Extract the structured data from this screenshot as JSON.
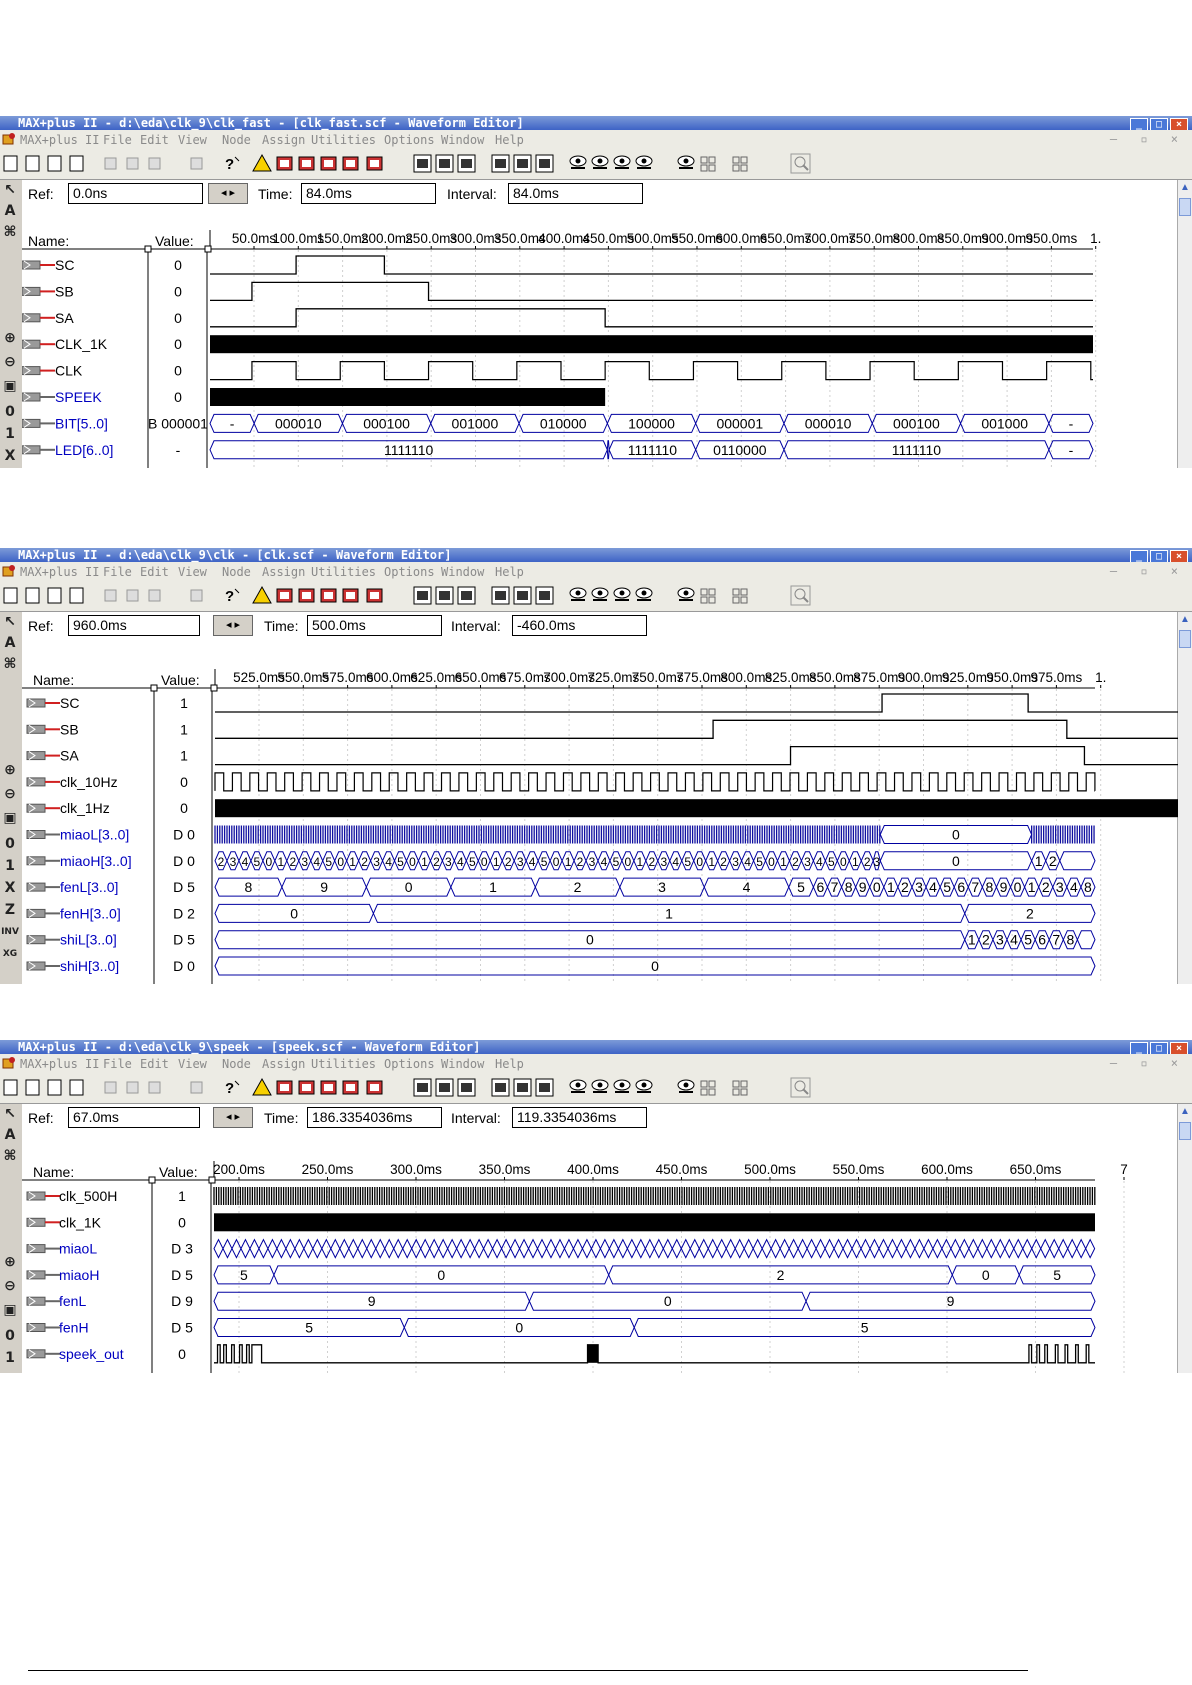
{
  "menu_items": [
    "MAX+plus II",
    "File",
    "Edit",
    "View",
    "Node",
    "Assign",
    "Utilities",
    "Options",
    "Window",
    "Help"
  ],
  "labels": {
    "ref": "Ref:",
    "time": "Time:",
    "interval": "Interval:",
    "name": "Name:",
    "value": "Value:"
  },
  "colors": {
    "input_name": "#000000",
    "output_name": "#0000c0",
    "title_grad_top": "#7d9bd8",
    "title_grad_bottom": "#3e63c6"
  },
  "windows": [
    {
      "title": "MAX+plus II - d:\\eda\\clk_9\\clk_fast - [clk_fast.scf - Waveform Editor]",
      "ref": "0.0ns",
      "time": "84.0ms",
      "interval": "84.0ms",
      "ticks": [
        "50.0ms",
        "100.0ms",
        "150.0ms",
        "200.0ms",
        "250.0ms",
        "300.0ms",
        "350.0ms",
        "400.0ms",
        "450.0ms",
        "500.0ms",
        "550.0ms",
        "600.0ms",
        "650.0ms",
        "700.0ms",
        "750.0ms",
        "800.0ms",
        "850.0ms",
        "900.0ms",
        "950.0ms",
        "1."
      ],
      "signals": [
        {
          "name": "SC",
          "value": "0",
          "type": "in",
          "kind": "bit",
          "t": [
            0,
            97.5,
            197.5,
            1000
          ],
          "v": [
            0,
            1,
            0
          ]
        },
        {
          "name": "SB",
          "value": "0",
          "type": "in",
          "kind": "bit",
          "t": [
            0,
            47.5,
            247.5,
            1000
          ],
          "v": [
            0,
            1,
            0
          ]
        },
        {
          "name": "SA",
          "value": "0",
          "type": "in",
          "kind": "bit",
          "t": [
            0,
            97.5,
            447.5,
            1000
          ],
          "v": [
            0,
            1,
            0
          ]
        },
        {
          "name": "CLK_1K",
          "value": "0",
          "type": "in",
          "kind": "fill",
          "ranges": [
            [
              0,
              1000
            ]
          ]
        },
        {
          "name": "CLK",
          "value": "0",
          "type": "in",
          "kind": "clock",
          "period": 100,
          "phase": 50
        },
        {
          "name": "SPEEK",
          "value": "0",
          "type": "out",
          "kind": "fill",
          "ranges": [
            [
              0,
              447.5
            ]
          ]
        },
        {
          "name": "BIT[5..0]",
          "value": "B 000001",
          "type": "out",
          "kind": "bus",
          "t": [
            0,
            50,
            150,
            250,
            350,
            450,
            550,
            650,
            750,
            850,
            950,
            1000
          ],
          "labels": [
            "-",
            "000010",
            "000100",
            "001000",
            "010000",
            "100000",
            "000001",
            "000010",
            "000100",
            "001000",
            "-"
          ]
        },
        {
          "name": "LED[6..0]",
          "value": "-",
          "type": "out",
          "kind": "bus",
          "t": [
            0,
            450,
            452,
            550,
            650,
            950,
            1000
          ],
          "labels": [
            "1111110",
            "",
            "1111110",
            "0110000",
            "1111110",
            "-"
          ]
        }
      ]
    },
    {
      "title": "MAX+plus II - d:\\eda\\clk_9\\clk - [clk.scf - Waveform Editor]",
      "ref": "960.0ms",
      "time": "500.0ms",
      "interval": "-460.0ms",
      "ticks": [
        "525.0ms",
        "550.0ms",
        "575.0ms",
        "600.0ms",
        "625.0ms",
        "650.0ms",
        "675.0ms",
        "700.0ms",
        "725.0ms",
        "750.0ms",
        "775.0ms",
        "800.0ms",
        "825.0ms",
        "850.0ms",
        "875.0ms",
        "900.0ms",
        "925.0ms",
        "950.0ms",
        "975.0ms",
        "1."
      ],
      "signals": [
        {
          "name": "SC",
          "value": "1",
          "type": "in",
          "kind": "bit",
          "t": [
            0,
            189.5,
            231,
            1000
          ],
          "v": [
            0,
            1,
            0
          ]
        },
        {
          "name": "SB",
          "value": "1",
          "type": "in",
          "kind": "bit",
          "t": [
            0,
            141.5,
            242,
            1000
          ],
          "v": [
            0,
            1,
            0
          ]
        },
        {
          "name": "SA",
          "value": "1",
          "type": "in",
          "kind": "bit",
          "t": [
            0,
            163.5,
            247,
            1000
          ],
          "v": [
            0,
            1,
            0
          ]
        },
        {
          "name": "clk_10Hz",
          "value": "0",
          "type": "in",
          "kind": "clock",
          "period": 4.95,
          "phase": 0
        },
        {
          "name": "clk_1Hz",
          "value": "0",
          "type": "in",
          "kind": "fill",
          "ranges": [
            [
              0,
              1000
            ]
          ]
        },
        {
          "name": "miaoL[3..0]",
          "value": "D 0",
          "type": "out",
          "kind": "dense",
          "ranges": [
            [
              0,
              189
            ],
            [
              232,
              250
            ]
          ],
          "gap_label": "0",
          "gap": [
            189,
            232
          ]
        },
        {
          "name": "miaoH[3..0]",
          "value": "D 0",
          "type": "out",
          "kind": "bus",
          "t": [
            0,
            3.4,
            6.8,
            10.2,
            13.6,
            17,
            20.4,
            23.8,
            27.2,
            30.6,
            34,
            37.4,
            40.8,
            44.2,
            47.6,
            51,
            54.4,
            57.8,
            61.2,
            64.6,
            68,
            71.4,
            74.8,
            78.2,
            81.6,
            85,
            88.4,
            91.8,
            95.2,
            98.6,
            102,
            105.4,
            108.8,
            112.2,
            115.6,
            119,
            122.4,
            125.8,
            129.2,
            132.6,
            136,
            139.4,
            142.8,
            146.2,
            149.6,
            153,
            156.4,
            159.8,
            163.2,
            166.6,
            170,
            173.4,
            176.8,
            180.2,
            183.6,
            187,
            189,
            232,
            236,
            240,
            250
          ],
          "labels": [
            "2",
            "3",
            "4",
            "5",
            "0",
            "1",
            "2",
            "3",
            "4",
            "5",
            "0",
            "1",
            "2",
            "3",
            "4",
            "5",
            "0",
            "1",
            "2",
            "3",
            "4",
            "5",
            "0",
            "1",
            "2",
            "3",
            "4",
            "5",
            "0",
            "1",
            "2",
            "3",
            "4",
            "5",
            "0",
            "1",
            "2",
            "3",
            "4",
            "5",
            "0",
            "1",
            "2",
            "3",
            "4",
            "5",
            "0",
            "1",
            "2",
            "3",
            "4",
            "5",
            "0",
            "1",
            "2",
            "3",
            "0",
            "1",
            "2",
            ""
          ]
        },
        {
          "name": "fenL[3..0]",
          "value": "D 5",
          "type": "out",
          "kind": "bus",
          "t": [
            0,
            19,
            43,
            67,
            91,
            115,
            139,
            163,
            170,
            174,
            178,
            182,
            186,
            190,
            194,
            198,
            202,
            206,
            210,
            214,
            218,
            222,
            226,
            230,
            234,
            238,
            242,
            246,
            250
          ],
          "labels": [
            "8",
            "9",
            "0",
            "1",
            "2",
            "3",
            "4",
            "5",
            "6",
            "7",
            "8",
            "9",
            "0",
            "1",
            "2",
            "3",
            "4",
            "5",
            "6",
            "7",
            "8",
            "9",
            "0",
            "1",
            "2",
            "3",
            "4",
            "8"
          ]
        },
        {
          "name": "fenH[3..0]",
          "value": "D 2",
          "type": "out",
          "kind": "bus",
          "t": [
            0,
            45,
            213,
            250
          ],
          "labels": [
            "0",
            "1",
            "2"
          ]
        },
        {
          "name": "shiL[3..0]",
          "value": "D 5",
          "type": "out",
          "kind": "bus",
          "t": [
            0,
            213,
            217,
            221,
            225,
            229,
            233,
            237,
            241,
            245,
            250
          ],
          "labels": [
            "0",
            "1",
            "2",
            "3",
            "4",
            "5",
            "6",
            "7",
            "8",
            ""
          ]
        },
        {
          "name": "shiH[3..0]",
          "value": "D 0",
          "type": "out",
          "kind": "bus",
          "t": [
            0,
            250
          ],
          "labels": [
            "0"
          ]
        }
      ]
    },
    {
      "title": "MAX+plus II - d:\\eda\\clk_9\\speek - [speek.scf - Waveform Editor]",
      "ref": "67.0ms",
      "time": "186.3354036ms",
      "interval": "119.3354036ms",
      "ticks": [
        "200.0ms",
        "250.0ms",
        "300.0ms",
        "350.0ms",
        "400.0ms",
        "450.0ms",
        "500.0ms",
        "550.0ms",
        "600.0ms",
        "650.0ms",
        "7"
      ],
      "signals": [
        {
          "name": "clk_500H",
          "value": "1",
          "type": "in",
          "kind": "dense",
          "ranges": [
            [
              0,
              1000
            ]
          ]
        },
        {
          "name": "clk_1K",
          "value": "0",
          "type": "in",
          "kind": "fill",
          "ranges": [
            [
              0,
              1000
            ]
          ]
        },
        {
          "name": "miaoL",
          "value": "D 3",
          "type": "out",
          "kind": "chain",
          "step": 10.2
        },
        {
          "name": "miaoH",
          "value": "D 5",
          "type": "out",
          "kind": "bus",
          "t": [
            0,
            68,
            448,
            838,
            914,
            1000
          ],
          "labels": [
            "5",
            "0",
            "2",
            "0",
            "5"
          ]
        },
        {
          "name": "fenL",
          "value": "D 9",
          "type": "out",
          "kind": "bus",
          "t": [
            0,
            358,
            672,
            1000
          ],
          "labels": [
            "9",
            "0",
            "9"
          ]
        },
        {
          "name": "fenH",
          "value": "D 5",
          "type": "out",
          "kind": "bus",
          "t": [
            0,
            216,
            477,
            1000
          ],
          "labels": [
            "5",
            "0",
            "5"
          ]
        },
        {
          "name": "speek_out",
          "value": "0",
          "type": "out",
          "kind": "pulses",
          "ranges": [
            [
              4,
              7
            ],
            [
              11,
              14
            ],
            [
              20,
              23
            ],
            [
              29,
              32
            ],
            [
              37,
              40
            ],
            [
              43,
              54
            ],
            [
              424,
              436
            ],
            [
              925,
              928
            ],
            [
              934,
              937
            ],
            [
              943,
              946
            ],
            [
              955,
              958
            ],
            [
              966,
              969
            ],
            [
              978,
              981
            ],
            [
              990,
              993
            ]
          ]
        }
      ]
    }
  ]
}
